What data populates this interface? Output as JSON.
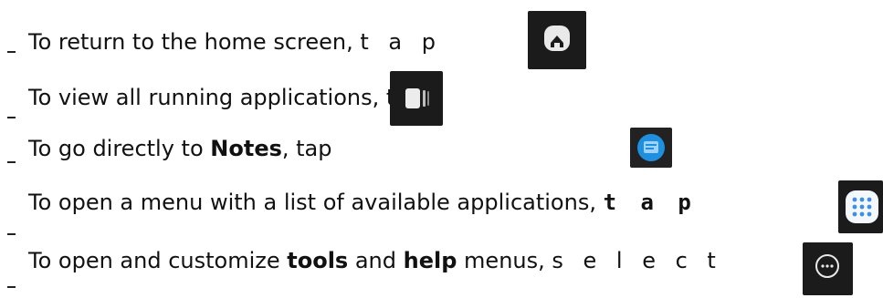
{
  "rows": [
    {
      "prefix": "To return to the home screen,",
      "action": "t a p",
      "icon": "home-icon"
    },
    {
      "prefix": "To view all running applications, tap",
      "icon": "recent-apps-icon"
    },
    {
      "prefix": "To go directly to ",
      "bold": "Notes",
      "suffix": ", tap",
      "icon": "notes-icon"
    },
    {
      "prefix": "To open a menu with a list of available applications,",
      "action": "t a p",
      "icon": "app-drawer-icon"
    },
    {
      "prefix": "To open and customize ",
      "bold1": "tools",
      "mid": " and ",
      "bold2": "help",
      "suffix": " menus,",
      "action": "s e l e c t",
      "icon": "more-options-icon"
    }
  ],
  "colors": {
    "icon_bg": "#1b1b1b",
    "icon_fg": "#e9e9e9",
    "notes_blue": "#1f8fe0",
    "grid_blue": "#3c8fe8"
  }
}
